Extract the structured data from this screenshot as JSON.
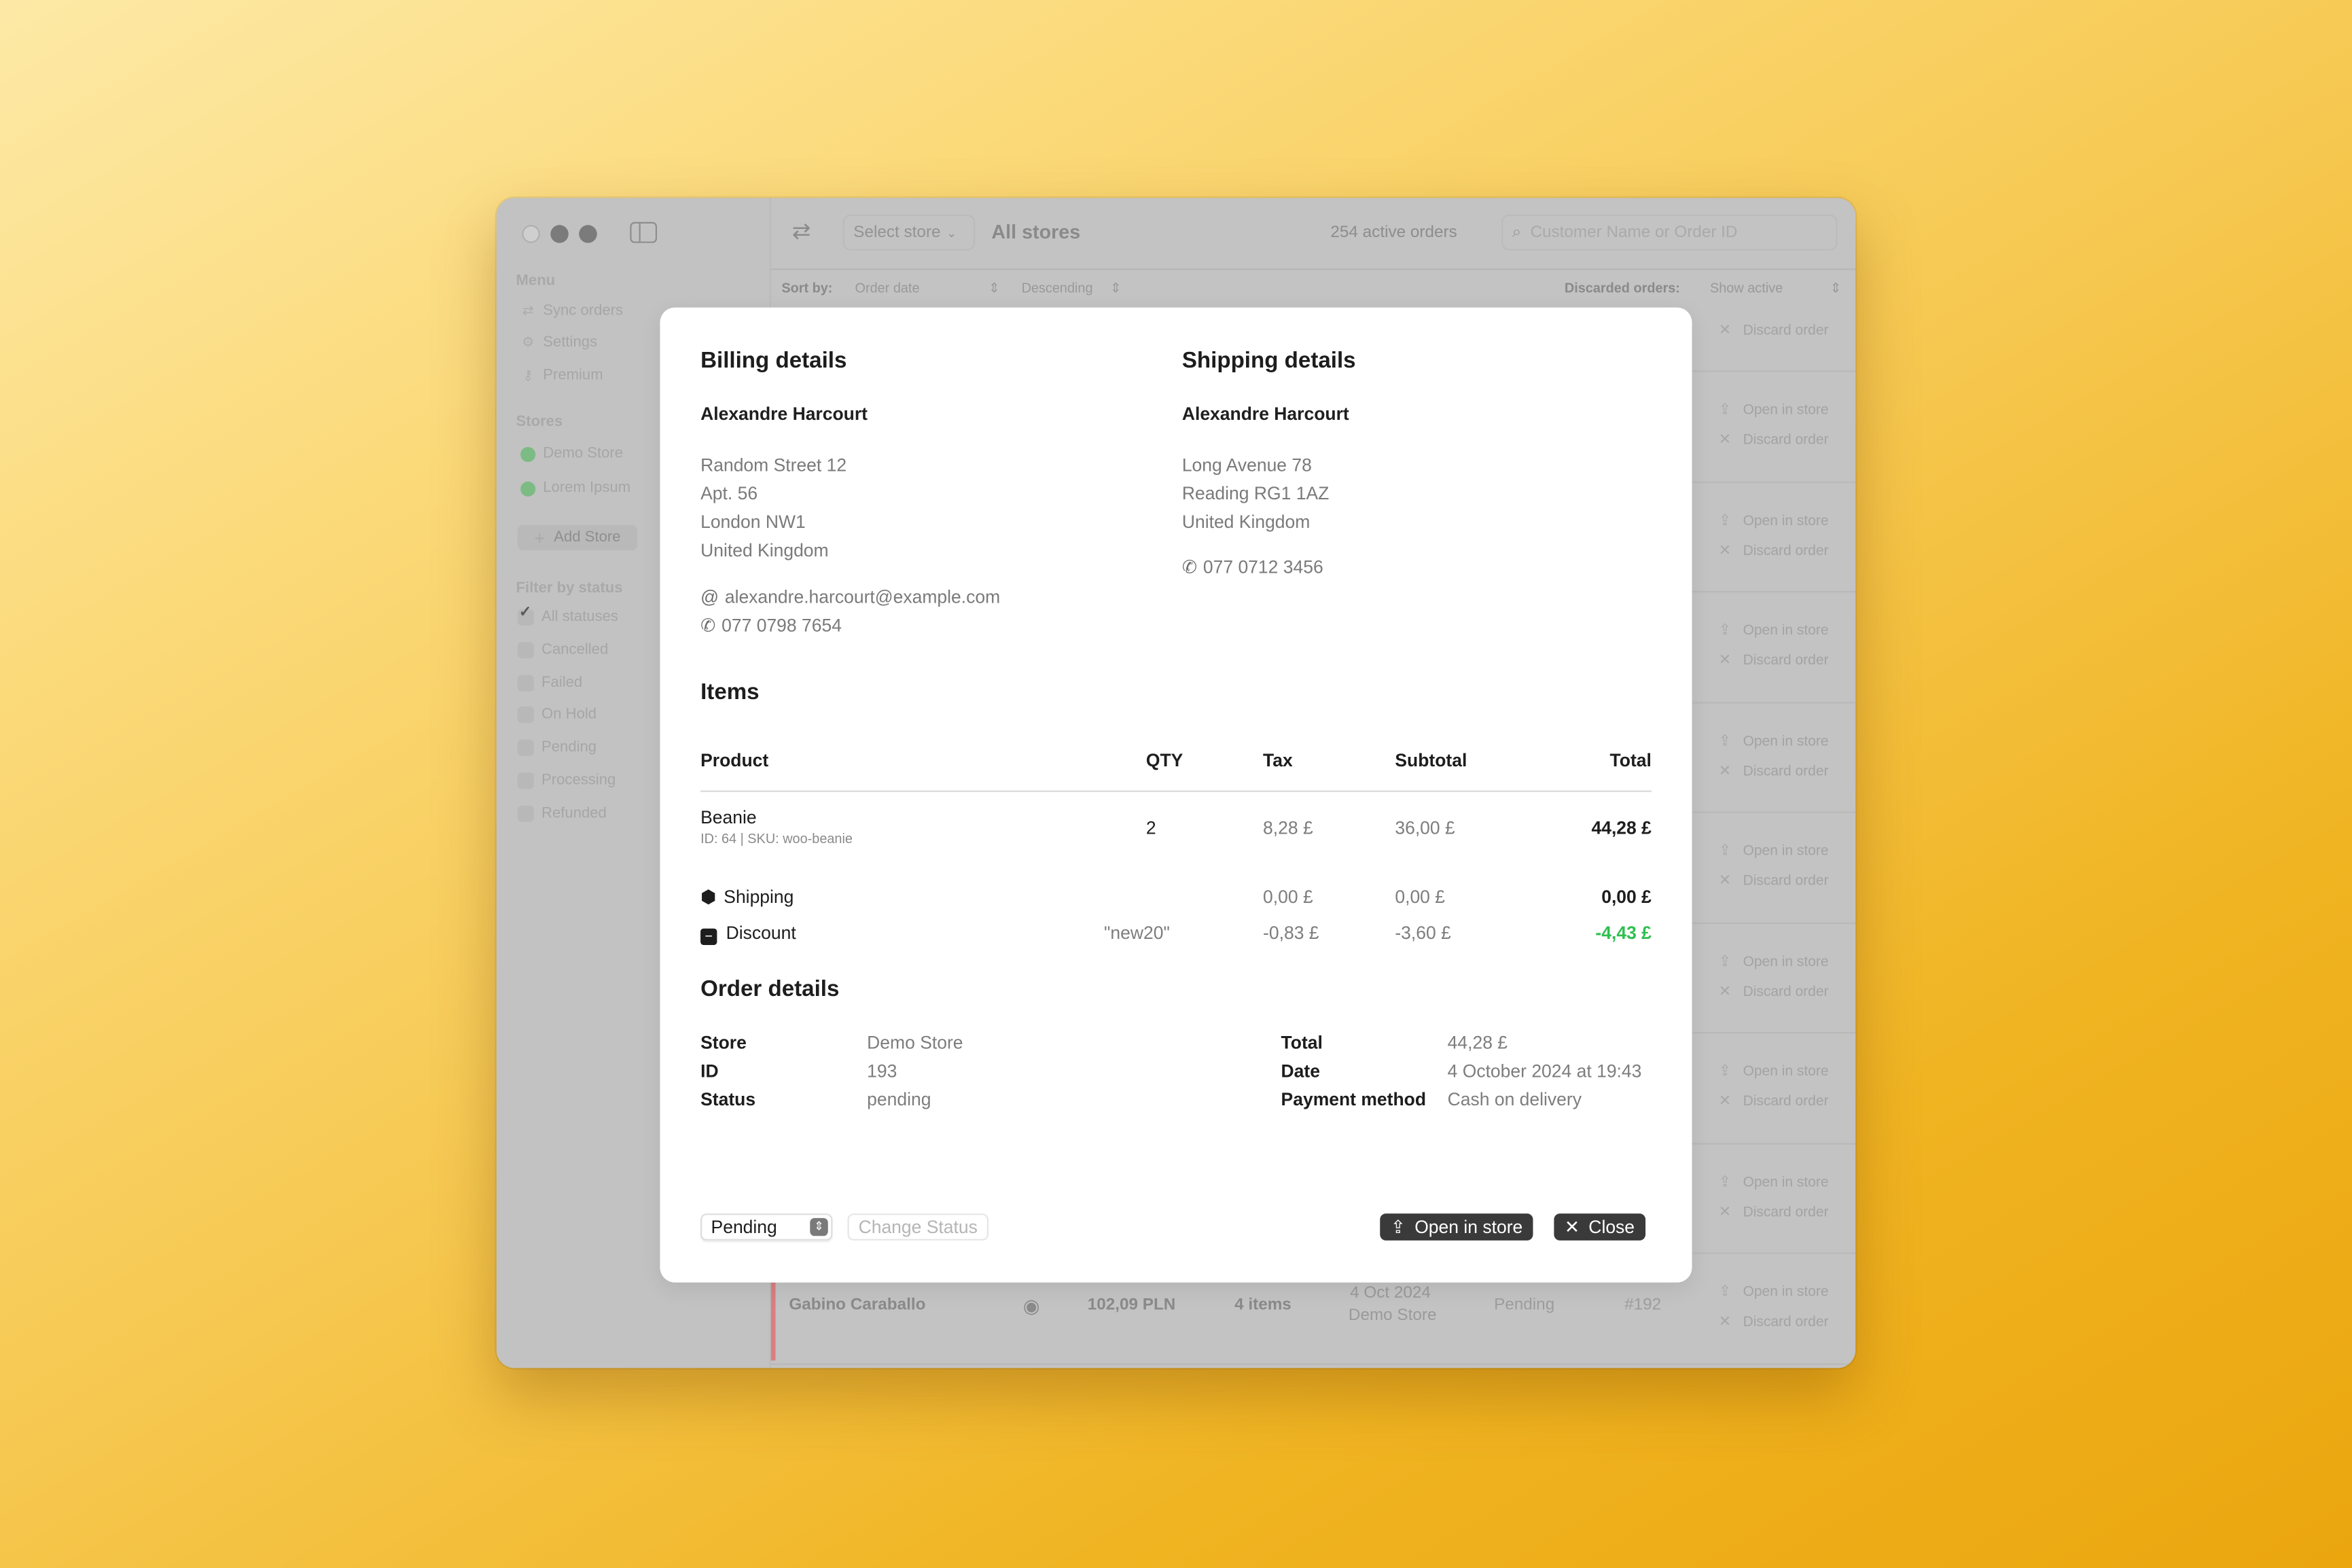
{
  "window": {
    "sidebar": {
      "menu_title": "Menu",
      "menu_items": [
        {
          "label": "Sync orders",
          "icon": "sync-icon"
        },
        {
          "label": "Settings",
          "icon": "gear-icon"
        },
        {
          "label": "Premium",
          "icon": "key-icon"
        }
      ],
      "stores_title": "Stores",
      "stores": [
        {
          "label": "Demo Store",
          "status_color": "#7cbb84"
        },
        {
          "label": "Lorem Ipsum",
          "status_color": "#7cbb84"
        }
      ],
      "add_store_label": "Add Store",
      "filter_title": "Filter by status",
      "filters": [
        {
          "label": "All statuses",
          "checked": true
        },
        {
          "label": "Cancelled",
          "checked": false
        },
        {
          "label": "Failed",
          "checked": false
        },
        {
          "label": "On Hold",
          "checked": false
        },
        {
          "label": "Pending",
          "checked": false
        },
        {
          "label": "Processing",
          "checked": false
        },
        {
          "label": "Refunded",
          "checked": false
        }
      ]
    },
    "toolbar": {
      "store_select_label": "Select store",
      "title": "All stores",
      "active_orders": "254 active orders",
      "search_placeholder": "Customer Name or Order ID"
    },
    "sort": {
      "sort_by_label": "Sort by:",
      "sort_field": "Order date",
      "sort_order": "Descending",
      "discarded_label": "Discarded orders:",
      "discarded_value": "Show active"
    },
    "row_actions": {
      "open_label": "Open in store",
      "discard_label": "Discard order"
    },
    "visible_row": {
      "customer": "Gabino Caraballo",
      "amount": "102,09 PLN",
      "items": "4 items",
      "date": "4 Oct 2024",
      "store": "Demo Store",
      "status": "Pending",
      "order_id": "#192",
      "status_color": "#d97f7f"
    }
  },
  "modal": {
    "billing": {
      "title": "Billing details",
      "name": "Alexandre Harcourt",
      "address": [
        "Random Street 12",
        "Apt. 56",
        "London NW1",
        "United Kingdom"
      ],
      "email": "alexandre.harcourt@example.com",
      "phone": "077 0798 7654"
    },
    "shipping": {
      "title": "Shipping details",
      "name": "Alexandre Harcourt",
      "address": [
        "Long Avenue 78",
        "Reading RG1 1AZ",
        "United Kingdom"
      ],
      "phone": "077 0712 3456"
    },
    "items": {
      "title": "Items",
      "columns": [
        "Product",
        "QTY",
        "Tax",
        "Subtotal",
        "Total"
      ],
      "products": [
        {
          "name": "Beanie",
          "meta": "ID: 64 | SKU: woo-beanie",
          "qty": "2",
          "tax": "8,28 £",
          "subtotal": "36,00 £",
          "total": "44,28 £"
        }
      ],
      "shipping": {
        "label": "Shipping",
        "tax": "0,00 £",
        "subtotal": "0,00 £",
        "total": "0,00 £"
      },
      "discount": {
        "label": "Discount",
        "code": "\"new20\"",
        "tax": "-0,83 £",
        "subtotal": "-3,60 £",
        "total": "-4,43 £",
        "total_color": "#2fbf4f"
      }
    },
    "order_details": {
      "title": "Order details",
      "left": [
        {
          "key": "Store",
          "value": "Demo Store"
        },
        {
          "key": "ID",
          "value": "193"
        },
        {
          "key": "Status",
          "value": "pending"
        }
      ],
      "right": [
        {
          "key": "Total",
          "value": "44,28 £"
        },
        {
          "key": "Date",
          "value": "4 October 2024 at 19:43"
        },
        {
          "key": "Payment method",
          "value": "Cash on delivery"
        }
      ]
    },
    "footer": {
      "status_value": "Pending",
      "change_status_label": "Change Status",
      "open_in_store_label": "Open in store",
      "close_label": "Close"
    }
  }
}
